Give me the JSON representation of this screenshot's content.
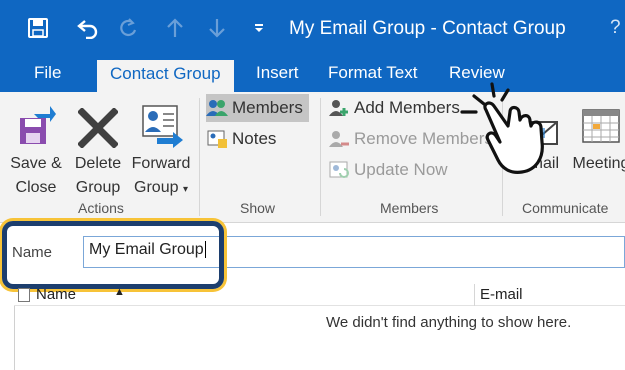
{
  "window": {
    "title": "My Email Group - Contact Group",
    "help": "?",
    "qat": [
      "save-icon",
      "undo-icon",
      "redo-icon",
      "up-arrow-icon",
      "down-arrow-icon",
      "customize-qat-icon"
    ]
  },
  "tabs": {
    "file": "File",
    "contact_group": "Contact Group",
    "insert": "Insert",
    "format_text": "Format Text",
    "review": "Review"
  },
  "ribbon": {
    "actions": {
      "save_close_line1": "Save &",
      "save_close_line2": "Close",
      "delete_line1": "Delete",
      "delete_line2": "Group",
      "forward_line1": "Forward",
      "forward_line2": "Group",
      "label": "Actions"
    },
    "show": {
      "members": "Members",
      "notes": "Notes",
      "label": "Show"
    },
    "members": {
      "add": "Add Members",
      "remove": "Remove Members",
      "update": "Update Now",
      "label": "Members"
    },
    "communicate": {
      "email": "Email",
      "meeting": "Meeting",
      "label": "Communicate"
    }
  },
  "form": {
    "name_label": "Name",
    "name_value": "My Email Group"
  },
  "list": {
    "col_name": "Name",
    "col_email": "E-mail",
    "sort_indicator": "▲",
    "empty_message": "We didn't find anything to show here."
  },
  "colors": {
    "accent": "#0f67c2",
    "ribbon_bg": "#f3f3f3",
    "callout_border": "#1c3e6e",
    "callout_glow": "#f7c338"
  }
}
